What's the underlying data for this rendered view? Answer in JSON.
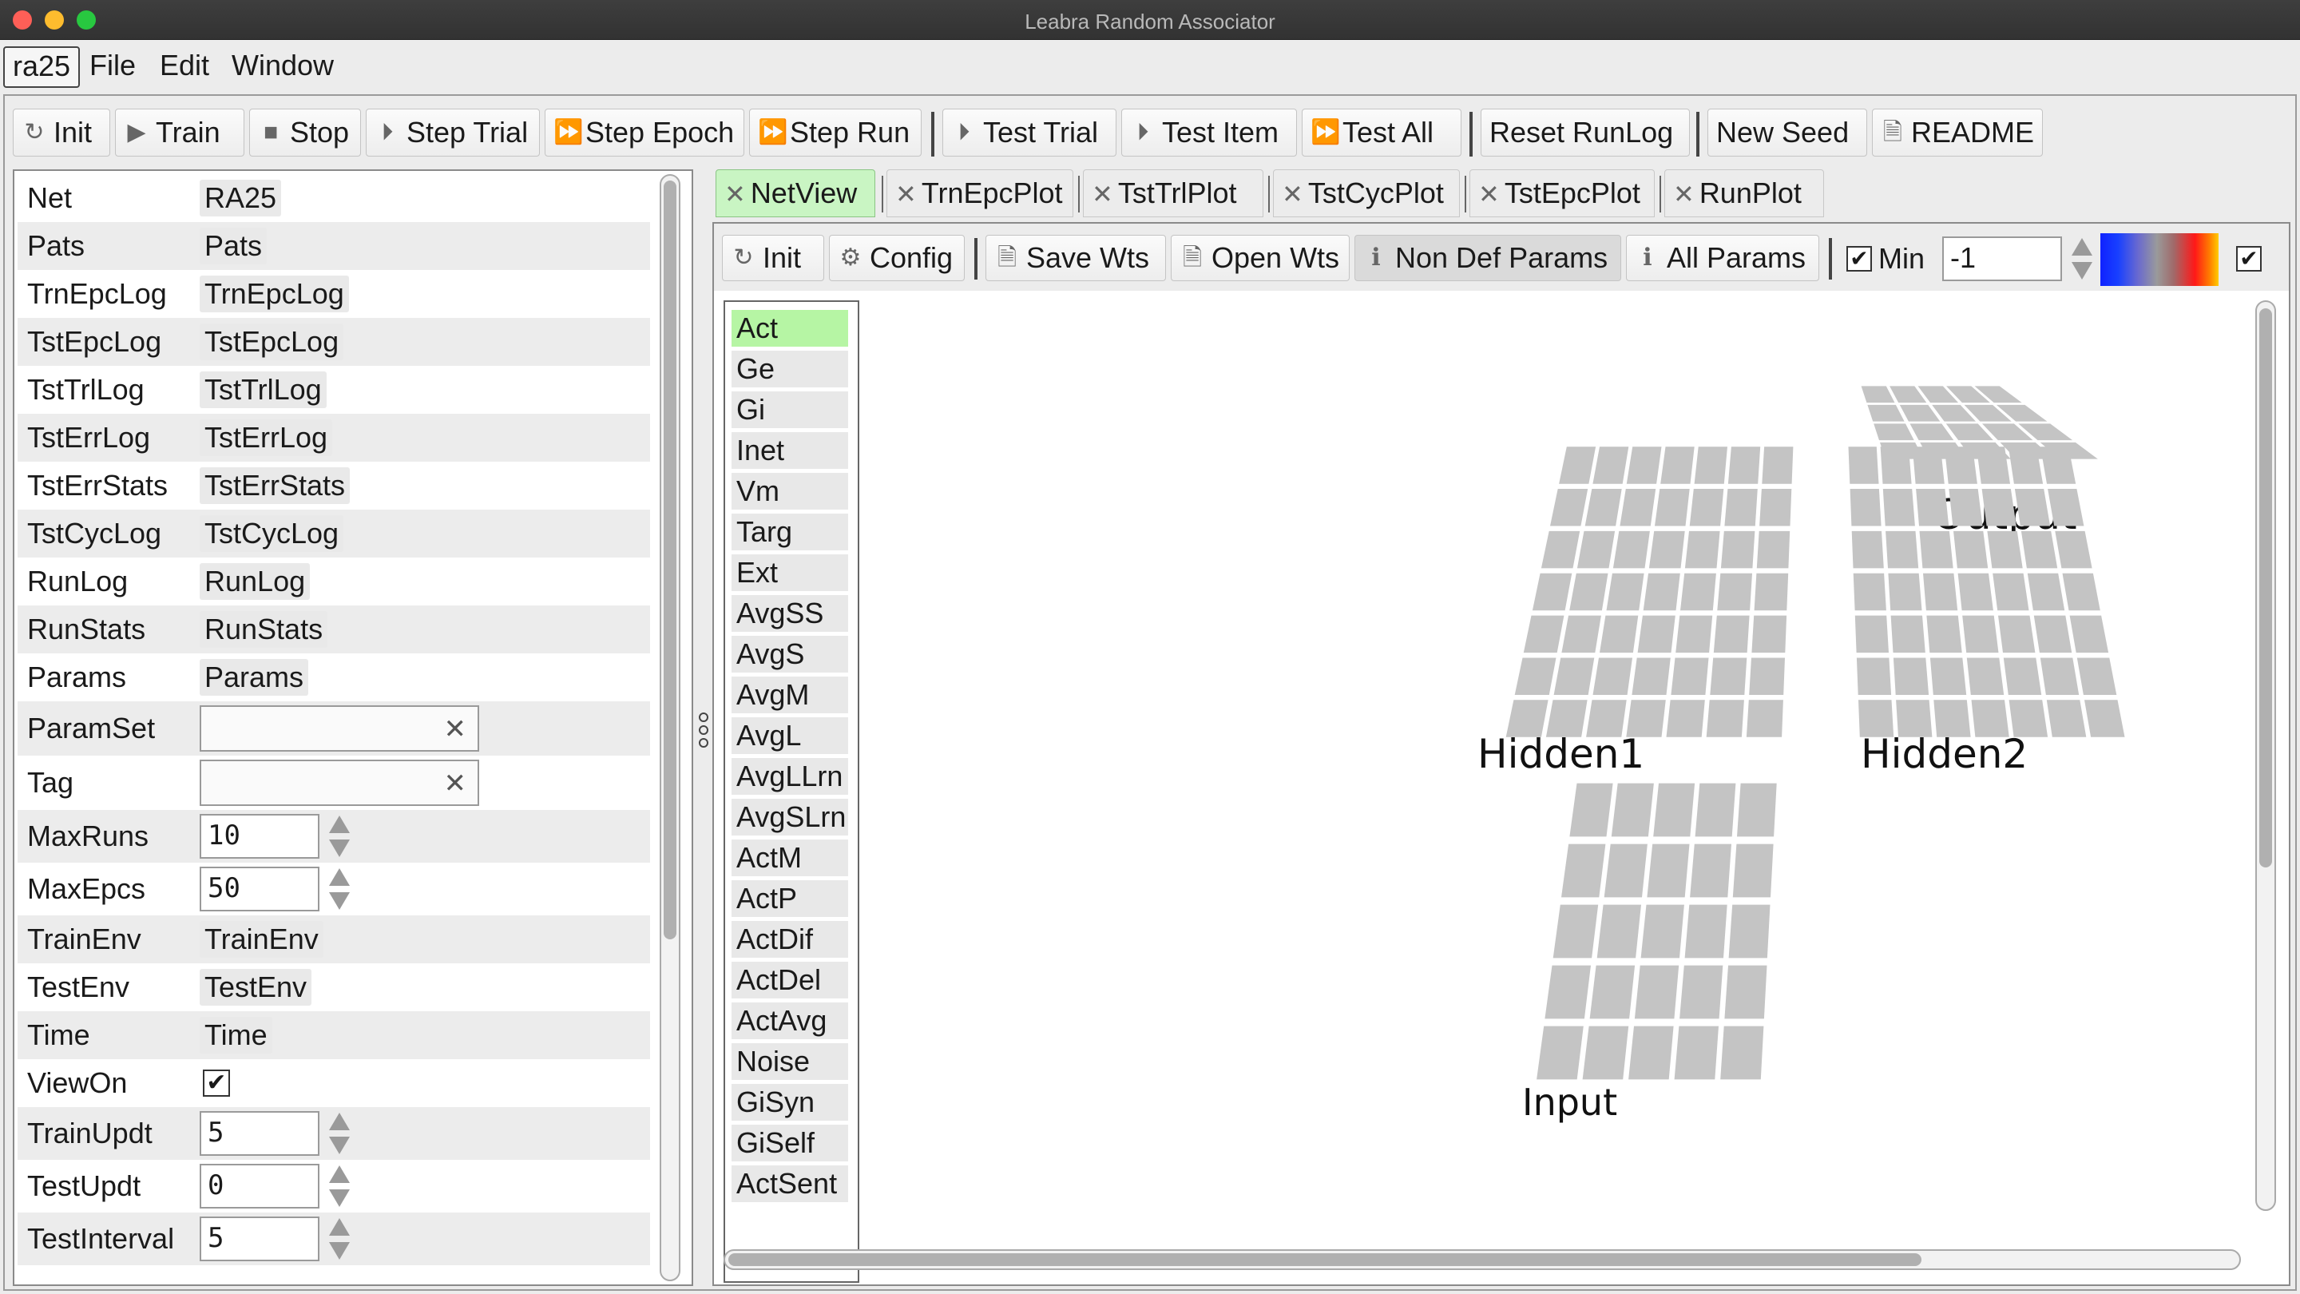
{
  "window": {
    "title": "Leabra Random Associator"
  },
  "menu": {
    "app": "ra25",
    "items": [
      "File",
      "Edit",
      "Window"
    ]
  },
  "toolbar": {
    "buttons": [
      {
        "label": "Init",
        "icon": "refresh-icon"
      },
      {
        "label": "Train",
        "icon": "play-icon"
      },
      {
        "label": "Stop",
        "icon": "stop-icon"
      },
      {
        "label": "Step Trial",
        "icon": "step-icon"
      },
      {
        "label": "Step Epoch",
        "icon": "fast-forward-icon"
      },
      {
        "label": "Step Run",
        "icon": "fast-forward-icon"
      },
      {
        "label": "Test Trial",
        "icon": "step-icon"
      },
      {
        "label": "Test Item",
        "icon": "step-icon"
      },
      {
        "label": "Test All",
        "icon": "fast-forward-icon"
      },
      {
        "label": "Reset RunLog",
        "icon": ""
      },
      {
        "label": "New Seed",
        "icon": ""
      },
      {
        "label": "README",
        "icon": "document-icon"
      }
    ]
  },
  "struct": {
    "rows": [
      {
        "label": "Net",
        "value": "RA25",
        "kind": "value"
      },
      {
        "label": "Pats",
        "value": "Pats",
        "kind": "value"
      },
      {
        "label": "TrnEpcLog",
        "value": "TrnEpcLog",
        "kind": "value"
      },
      {
        "label": "TstEpcLog",
        "value": "TstEpcLog",
        "kind": "value"
      },
      {
        "label": "TstTrlLog",
        "value": "TstTrlLog",
        "kind": "value"
      },
      {
        "label": "TstErrLog",
        "value": "TstErrLog",
        "kind": "value"
      },
      {
        "label": "TstErrStats",
        "value": "TstErrStats",
        "kind": "value"
      },
      {
        "label": "TstCycLog",
        "value": "TstCycLog",
        "kind": "value"
      },
      {
        "label": "RunLog",
        "value": "RunLog",
        "kind": "value"
      },
      {
        "label": "RunStats",
        "value": "RunStats",
        "kind": "value"
      },
      {
        "label": "Params",
        "value": "Params",
        "kind": "value"
      },
      {
        "label": "ParamSet",
        "value": "",
        "kind": "text"
      },
      {
        "label": "Tag",
        "value": "",
        "kind": "text"
      },
      {
        "label": "MaxRuns",
        "value": "10",
        "kind": "number"
      },
      {
        "label": "MaxEpcs",
        "value": "50",
        "kind": "number"
      },
      {
        "label": "TrainEnv",
        "value": "TrainEnv",
        "kind": "value"
      },
      {
        "label": "TestEnv",
        "value": "TestEnv",
        "kind": "value"
      },
      {
        "label": "Time",
        "value": "Time",
        "kind": "value"
      },
      {
        "label": "ViewOn",
        "value": "✔",
        "kind": "check"
      },
      {
        "label": "TrainUpdt",
        "value": "5",
        "kind": "number"
      },
      {
        "label": "TestUpdt",
        "value": "0",
        "kind": "number"
      },
      {
        "label": "TestInterval",
        "value": "5",
        "kind": "number"
      }
    ]
  },
  "tabs": [
    {
      "label": "NetView",
      "active": true
    },
    {
      "label": "TrnEpcPlot",
      "active": false
    },
    {
      "label": "TstTrlPlot",
      "active": false
    },
    {
      "label": "TstCycPlot",
      "active": false
    },
    {
      "label": "TstEpcPlot",
      "active": false
    },
    {
      "label": "RunPlot",
      "active": false
    }
  ],
  "netview_toolbar": {
    "init": "Init",
    "config": "Config",
    "save_wts": "Save Wts",
    "open_wts": "Open Wts",
    "non_def_params": "Non Def Params",
    "all_params": "All Params",
    "min_label": "Min",
    "min_value": "-1",
    "min_checked": "✔",
    "max_checked": "✔"
  },
  "variables": {
    "selected": "Act",
    "items": [
      "Act",
      "Ge",
      "Gi",
      "Inet",
      "Vm",
      "Targ",
      "Ext",
      "AvgSS",
      "AvgS",
      "AvgM",
      "AvgL",
      "AvgLLrn",
      "AvgSLrn",
      "ActM",
      "ActP",
      "ActDif",
      "ActDel",
      "ActAvg",
      "Noise",
      "GiSyn",
      "GiSelf",
      "ActSent"
    ]
  },
  "layers": [
    {
      "name": "Output",
      "rows": 4,
      "cols": 5
    },
    {
      "name": "Hidden1",
      "rows": 7,
      "cols": 7
    },
    {
      "name": "Hidden2",
      "rows": 7,
      "cols": 7
    },
    {
      "name": "Input",
      "rows": 5,
      "cols": 5
    }
  ],
  "colors": {
    "selected_tab": "#c9f5c3",
    "selected_var": "#b6f5a4",
    "unit": "#c4c4c4"
  }
}
